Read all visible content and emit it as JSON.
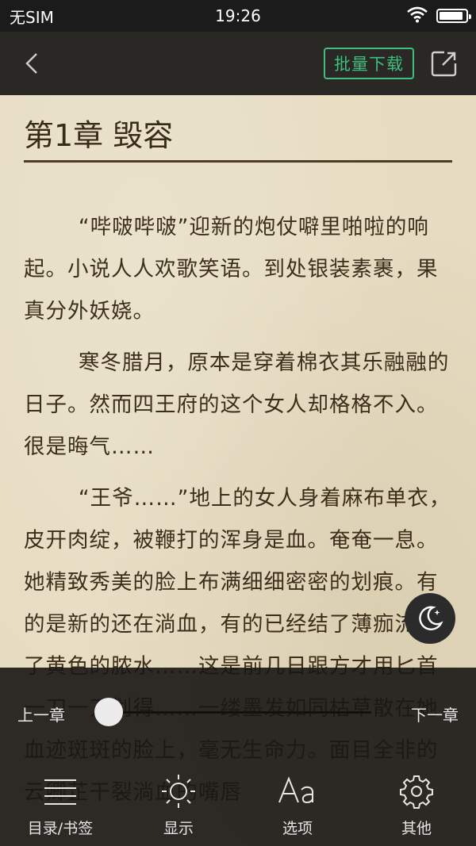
{
  "status_bar": {
    "carrier": "无SIM",
    "time": "19:26",
    "battery_level": 0.92
  },
  "toolbar": {
    "batch_download_label": "批量下载"
  },
  "chapter": {
    "title": "第1章 毁容",
    "paragraphs": [
      "“哔啵哔啵”迎新的炮仗噼里啪啦的响起。小说人人欢歌笑语。到处银装素裹，果真分外妖娆。",
      "寒冬腊月，原本是穿着棉衣其乐融融的日子。然而四王府的这个女人却格格不入。很是晦气……",
      "“王爷……”地上的女人身着麻布单衣，皮开肉绽，被鞭打的浑身是血。奄奄一息。她精致秀美的脸上布满细细密密的划痕。有的是新的还在淌血，有的已经结了薄痂流下了黄色的脓水……这是前几日跟方才用匕首一刀一刀划得……一缕墨发如同枯草散在她血迹斑斑的脸上，毫无生命力。面目全非的云卿芷干裂淌血的嘴唇"
    ]
  },
  "bottom_panel": {
    "prev_chapter": "上一章",
    "next_chapter": "下一章",
    "progress": 0.0,
    "tabs": [
      {
        "label": "目录/书签",
        "icon": "list-icon"
      },
      {
        "label": "显示",
        "icon": "brightness-icon"
      },
      {
        "label": "选项",
        "icon": "font-icon"
      },
      {
        "label": "其他",
        "icon": "gear-icon"
      }
    ]
  },
  "colors": {
    "accent": "#3fbf7f",
    "paper": "#e6dcc1",
    "text": "#3d2e1c",
    "panel": "#181614"
  }
}
